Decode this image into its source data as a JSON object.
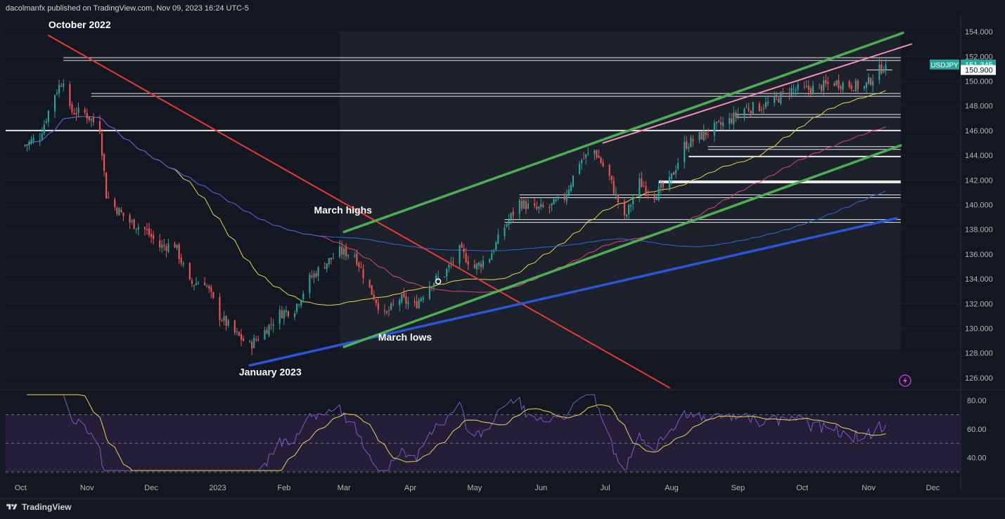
{
  "header": {
    "publish_line": "dacolmanfx published on TradingView.com, Nov 09, 2023 16:24 UTC-5"
  },
  "footer": {
    "brand": "TradingView"
  },
  "chart_data": [
    {
      "type": "candlestick",
      "symbol": "USDJPY",
      "last_price_label": "151.345",
      "secondary_price_label": "150.900",
      "y_ticks": [
        "154.000",
        "152.000",
        "150.000",
        "148.000",
        "146.000",
        "144.000",
        "142.000",
        "140.000",
        "138.000",
        "136.000",
        "134.000",
        "132.000",
        "130.000",
        "128.000",
        "126.000"
      ],
      "ylim": [
        125.2,
        155.2
      ],
      "x_ticks": [
        "Oct",
        "Nov",
        "Dec",
        "2023",
        "Feb",
        "Mar",
        "Apr",
        "May",
        "Jun",
        "Jul",
        "Aug",
        "Sep",
        "Oct",
        "Nov",
        "Dec"
      ],
      "close_series": {
        "dates": [
          "2022-10-03",
          "2022-10-10",
          "2022-10-17",
          "2022-10-21",
          "2022-10-24",
          "2022-10-31",
          "2022-11-07",
          "2022-11-10",
          "2022-11-14",
          "2022-11-21",
          "2022-11-28",
          "2022-12-05",
          "2022-12-12",
          "2022-12-19",
          "2022-12-26",
          "2023-01-02",
          "2023-01-09",
          "2023-01-16",
          "2023-01-23",
          "2023-01-30",
          "2023-02-06",
          "2023-02-13",
          "2023-02-20",
          "2023-02-27",
          "2023-03-06",
          "2023-03-13",
          "2023-03-20",
          "2023-03-27",
          "2023-04-03",
          "2023-04-10",
          "2023-04-17",
          "2023-04-24",
          "2023-05-01",
          "2023-05-08",
          "2023-05-15",
          "2023-05-22",
          "2023-05-29",
          "2023-06-05",
          "2023-06-12",
          "2023-06-19",
          "2023-06-26",
          "2023-07-03",
          "2023-07-10",
          "2023-07-17",
          "2023-07-24",
          "2023-07-31",
          "2023-08-07",
          "2023-08-14",
          "2023-08-21",
          "2023-08-28",
          "2023-09-04",
          "2023-09-11",
          "2023-09-18",
          "2023-09-25",
          "2023-10-02",
          "2023-10-09",
          "2023-10-16",
          "2023-10-23",
          "2023-10-30",
          "2023-11-06",
          "2023-11-09"
        ],
        "values": [
          144.8,
          145.6,
          149.0,
          150.2,
          147.6,
          147.4,
          146.2,
          140.8,
          139.8,
          138.6,
          138.0,
          136.6,
          136.8,
          133.6,
          133.8,
          131.0,
          129.6,
          128.6,
          129.8,
          131.2,
          131.6,
          134.0,
          135.2,
          136.2,
          136.0,
          133.2,
          131.0,
          132.4,
          131.8,
          133.6,
          134.4,
          136.3,
          134.9,
          135.8,
          138.2,
          140.2,
          139.6,
          139.8,
          140.6,
          143.5,
          144.4,
          142.2,
          138.8,
          141.8,
          140.8,
          141.8,
          144.8,
          145.5,
          146.2,
          146.8,
          147.8,
          147.9,
          148.4,
          149.3,
          149.3,
          149.5,
          149.9,
          149.7,
          149.5,
          150.9,
          151.345
        ]
      },
      "moving_averages": [
        {
          "color": "#e8d44d",
          "role": "50-period average (yellow)"
        },
        {
          "color": "#d9456e",
          "role": "100-period average (pink-red)"
        },
        {
          "color": "#3a62d9",
          "role": "200-period average (blue)"
        }
      ],
      "annotations": [
        "October 2022",
        "March highs",
        "March lows",
        "January 2023"
      ],
      "trendline_colors": {
        "channel": "#4caf50",
        "upper_trend": "#f48fb1",
        "down_trend": "#e53935",
        "support": "#2e54d6",
        "levels": "#e6e6e6"
      },
      "colors": {
        "up": "#26a69a",
        "down": "#ef5350",
        "price_badge": "#26a69a"
      }
    },
    {
      "type": "line",
      "indicator": "RSI",
      "y_ticks": [
        "80.00",
        "60.00",
        "40.00"
      ],
      "ylim": [
        30,
        85
      ],
      "upper_band": 70,
      "lower_band": 30,
      "middle_band": 50,
      "colors": {
        "rsi": "#7e57c2",
        "signal": "#e8d44d",
        "band_fill": "#2a2140"
      }
    }
  ]
}
